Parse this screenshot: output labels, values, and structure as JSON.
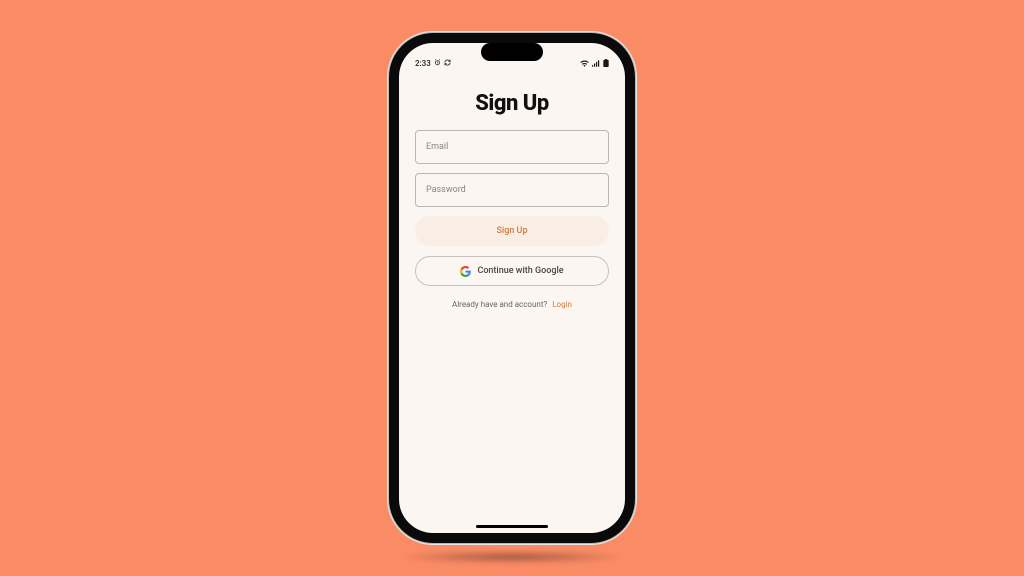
{
  "status": {
    "time": "2:33"
  },
  "screen": {
    "title": "Sign Up",
    "email_placeholder": "Email",
    "password_placeholder": "Password",
    "signup_button": "Sign Up",
    "google_button": "Continue with Google",
    "login_prompt": "Already have and account?",
    "login_link": "Login"
  },
  "colors": {
    "background": "#f98b65",
    "screen_bg": "#fbf6f2",
    "accent": "#d17a3f",
    "primary_btn_bg": "#f8eee6",
    "border": "#bdb6af"
  }
}
